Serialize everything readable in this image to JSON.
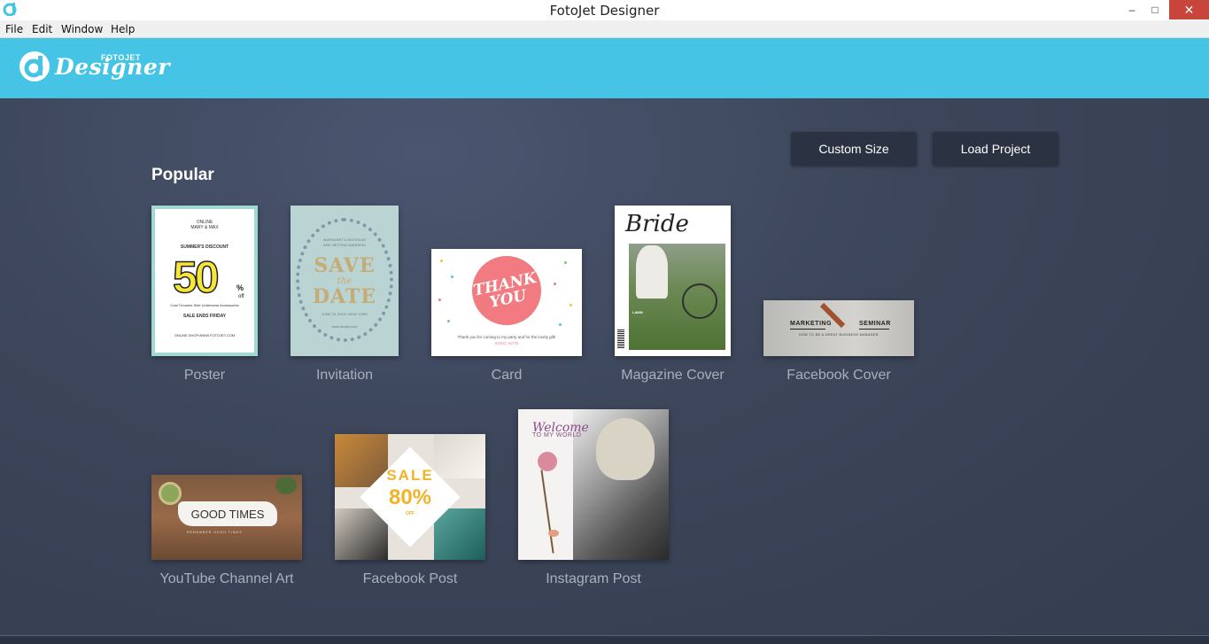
{
  "window": {
    "title": "FotoJet Designer",
    "min": "–",
    "max": "□",
    "close": "✕"
  },
  "menu": [
    "File",
    "Edit",
    "Window",
    "Help"
  ],
  "header": {
    "logo_main": "Designer",
    "logo_sub": "FOTOJET"
  },
  "buttons": {
    "custom_size": "Custom Size",
    "load_project": "Load Project"
  },
  "section_title": "Popular",
  "templates": [
    {
      "label": "Poster"
    },
    {
      "label": "Invitation"
    },
    {
      "label": "Card"
    },
    {
      "label": "Magazine Cover"
    },
    {
      "label": "Facebook Cover"
    },
    {
      "label": "YouTube Channel Art"
    },
    {
      "label": "Facebook Post"
    },
    {
      "label": "Instagram Post"
    }
  ],
  "poster": {
    "line1": "ONLINE",
    "line2": "MARY & MAX",
    "discount": "SUMMER'S DISCOUNT",
    "value": "50",
    "pct": "%",
    "off": "off",
    "items": "Coat    Trousers    Skirt    Underwear    Accessories",
    "ends": "SALE ENDS FRIDAY",
    "url": "ONLINE.SHOP.WWW.FOTOJET.COM"
  },
  "invitation": {
    "names": "MARGARET & NICHOLAS",
    "names2": "ARE GETTING MARRIED!",
    "save": "SAVE",
    "the": "the",
    "date": "DATE",
    "when": "JUNE 20, 2016 / NEW YORK",
    "url": "www.fotojet.com"
  },
  "card": {
    "thank_you": "THANK YOU",
    "message": "Thank you for coming to my party and for the lovely gift!",
    "sign": "XOXO, KATE"
  },
  "magazine": {
    "title": "Bride",
    "lawn": "LAWN"
  },
  "fb_cover": {
    "marketing": "MARKETING",
    "seminar": "SEMINAR",
    "sub": "HOW TO BE A GREAT BUSINESS MANAGER"
  },
  "youtube": {
    "text": "GOOD TIMES",
    "sub": "REMEMBER GOOD TIMES"
  },
  "fb_post": {
    "sale": "SALE",
    "value": "80%",
    "off": "OFF"
  },
  "instagram": {
    "welcome": "Welcome",
    "to_my_world": "TO MY WORLD"
  },
  "colors": {
    "header": "#45c4e6",
    "background": "#3a4356",
    "button": "#2b3242",
    "label": "#a9b0bd"
  }
}
